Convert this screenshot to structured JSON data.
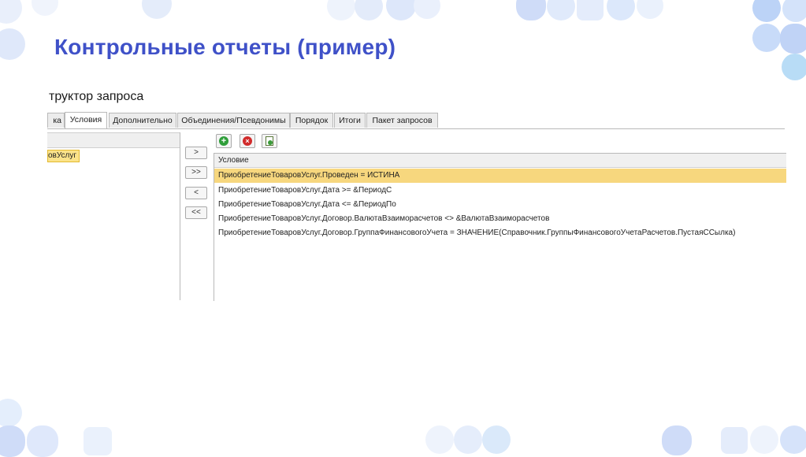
{
  "slide": {
    "title": "Контрольные отчеты (пример)"
  },
  "window": {
    "title": "труктор запроса"
  },
  "tabs": [
    {
      "label": "ка"
    },
    {
      "label": "Условия"
    },
    {
      "label": "Дополнительно"
    },
    {
      "label": "Объединения/Псевдонимы"
    },
    {
      "label": "Порядок"
    },
    {
      "label": "Итоги"
    },
    {
      "label": "Пакет запросов"
    }
  ],
  "left_panel": {
    "selected_item": "овУслуг"
  },
  "move_buttons": {
    "add": ">",
    "add_all": ">>",
    "remove": "<",
    "remove_all": "<<"
  },
  "toolbar": {
    "icons": [
      "add-icon",
      "delete-icon",
      "edit-condition-icon"
    ]
  },
  "grid": {
    "column_header": "Условие",
    "rows": [
      "ПриобретениеТоваровУслуг.Проведен = ИСТИНА",
      "ПриобретениеТоваровУслуг.Дата >= &ПериодС",
      "ПриобретениеТоваровУслуг.Дата <= &ПериодПо",
      "ПриобретениеТоваровУслуг.Договор.ВалютаВзаиморасчетов <> &ВалютаВзаиморасчетов",
      "ПриобретениеТоваровУслуг.Договор.ГруппаФинансовогоУчета = ЗНАЧЕНИЕ(Справочник.ГруппыФинансовогоУчетаРасчетов.ПустаяССылка)"
    ],
    "selected_row": 1
  },
  "colors": {
    "accent": "#3f51c8",
    "selection": "#f7d77e",
    "decor": "#c9d8f7"
  }
}
